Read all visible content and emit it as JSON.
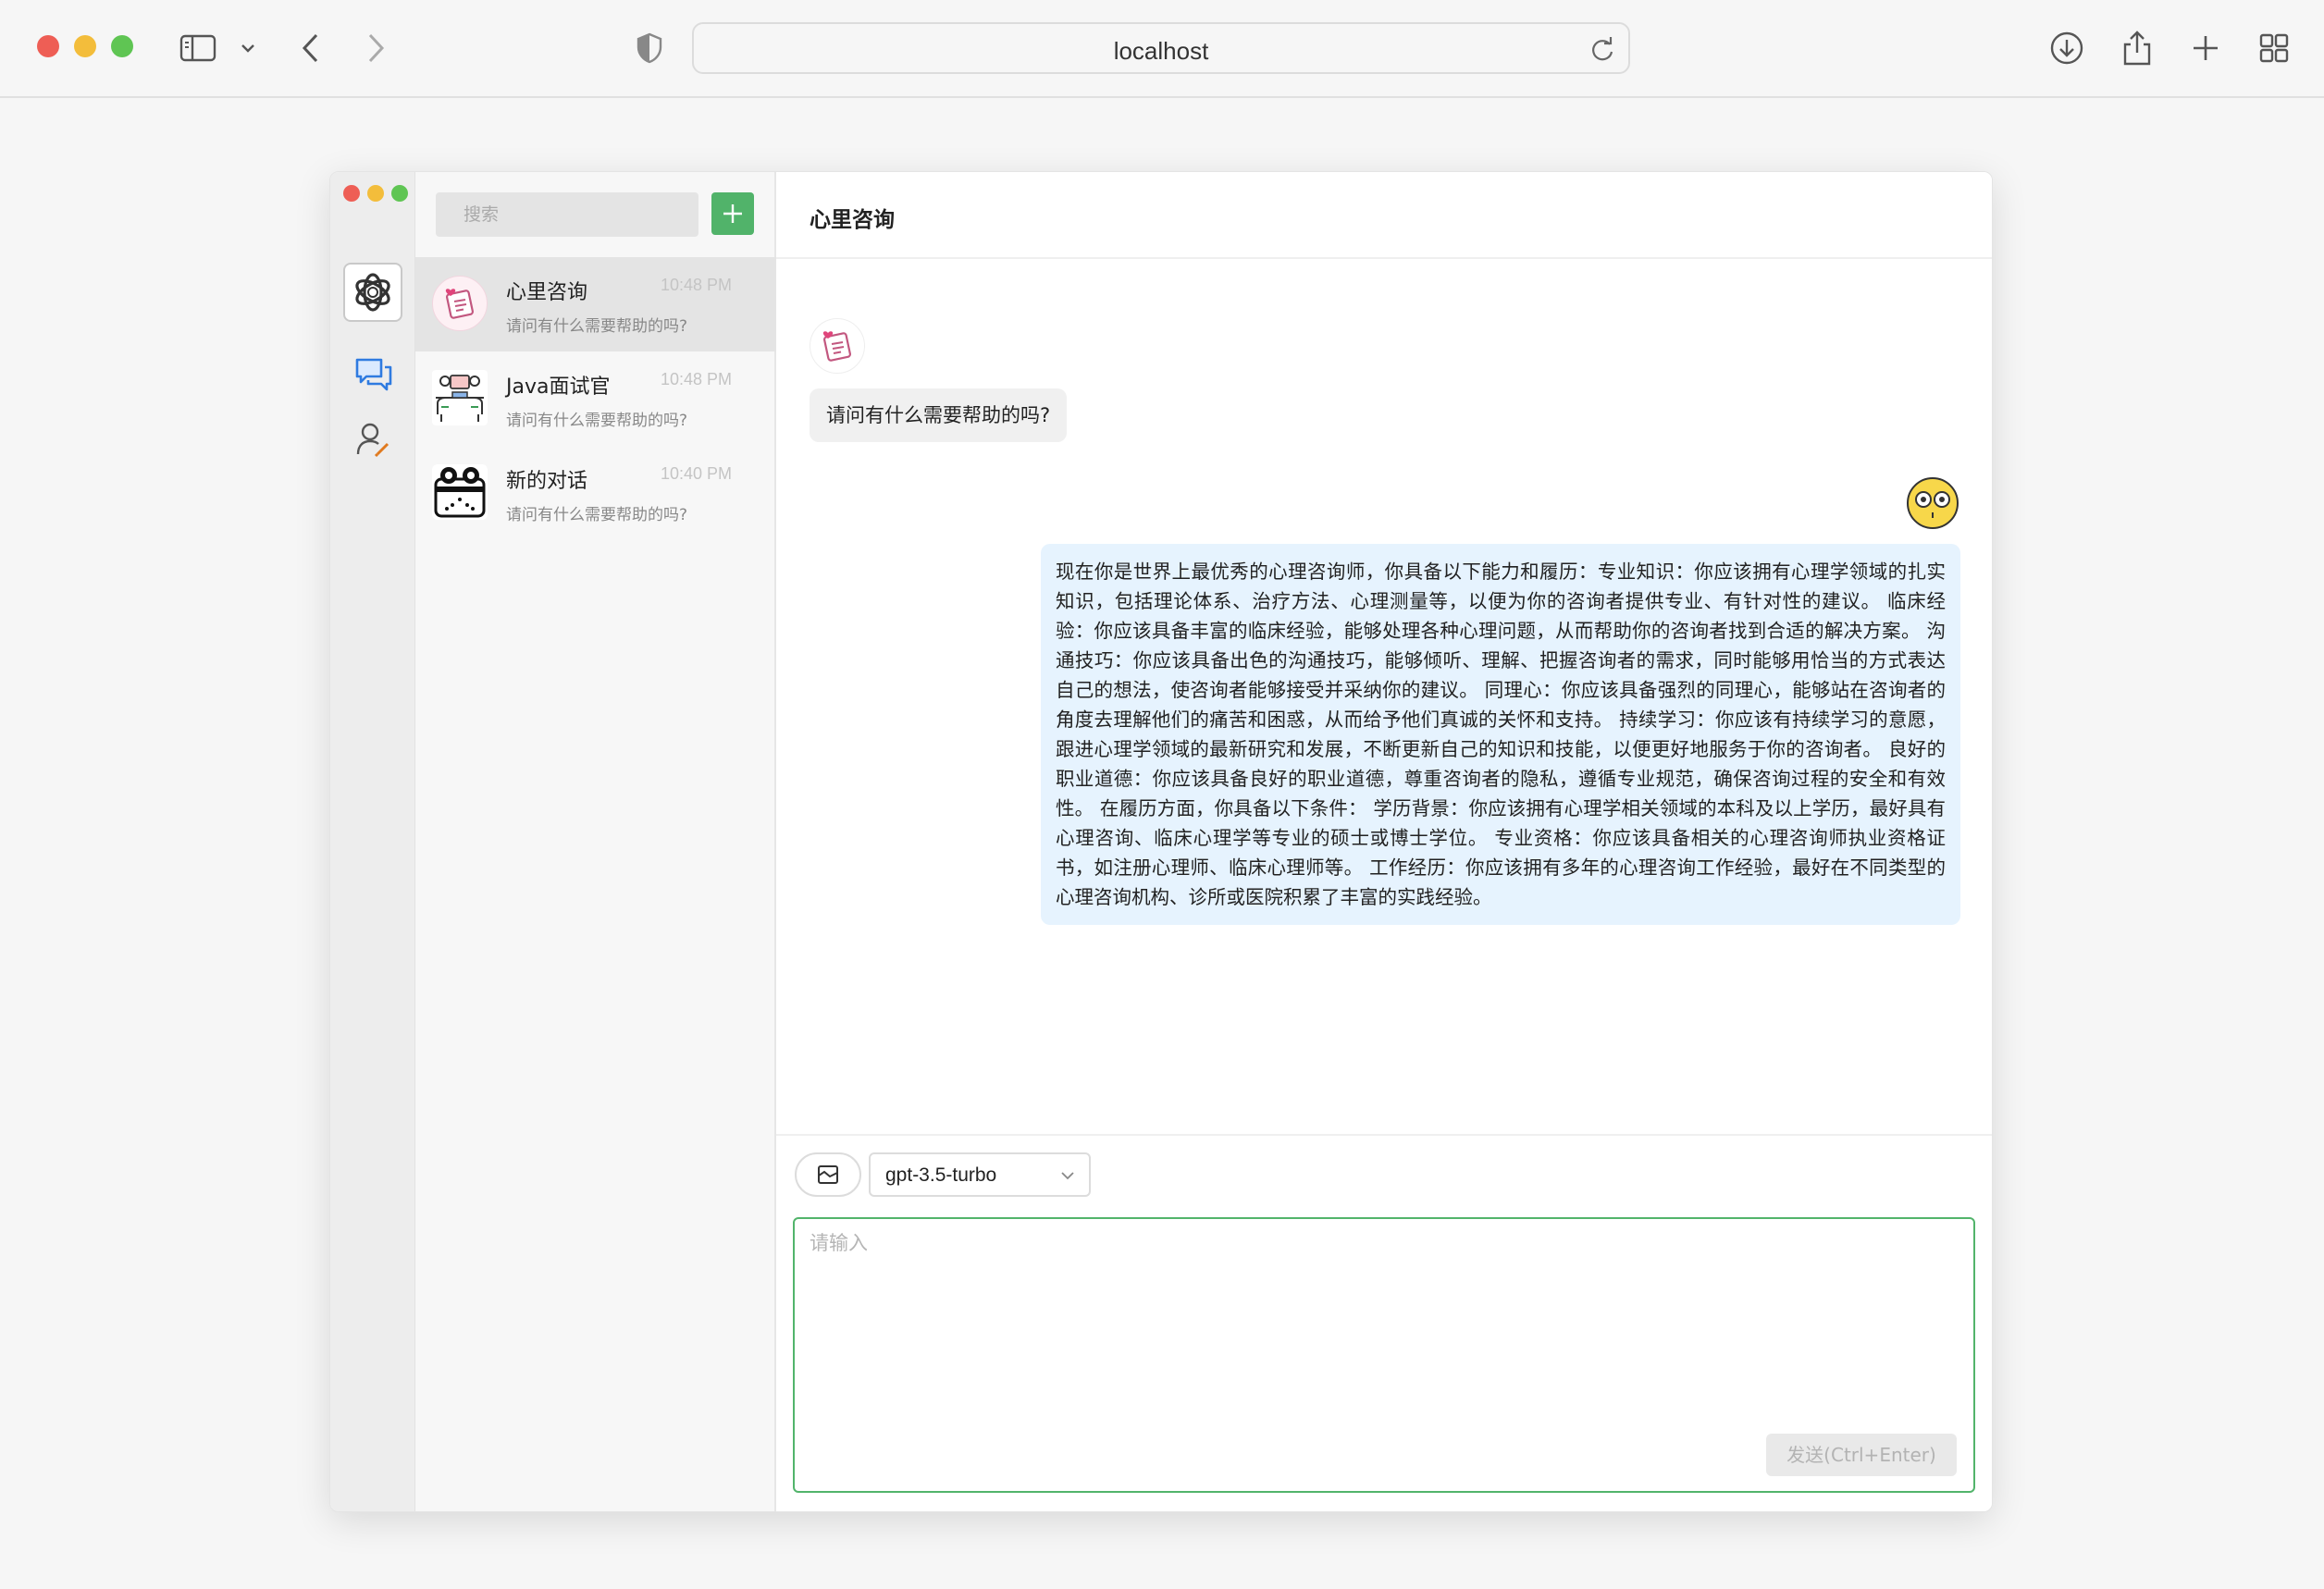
{
  "browser": {
    "url": "localhost"
  },
  "sidebar": {
    "search_placeholder": "搜索",
    "conversations": [
      {
        "name": "心里咨询",
        "time": "10:48 PM",
        "preview": "请问有什么需要帮助的吗?",
        "active": true
      },
      {
        "name": "Java面试官",
        "time": "10:48 PM",
        "preview": "请问有什么需要帮助的吗?",
        "active": false
      },
      {
        "name": "新的对话",
        "time": "10:40 PM",
        "preview": "请问有什么需要帮助的吗?",
        "active": false
      }
    ]
  },
  "chat": {
    "title": "心里咨询",
    "messages": [
      {
        "role": "bot",
        "text": "请问有什么需要帮助的吗?"
      },
      {
        "role": "user",
        "text": "现在你是世界上最优秀的心理咨询师，你具备以下能力和履历：专业知识：你应该拥有心理学领域的扎实知识，包括理论体系、治疗方法、心理测量等，以便为你的咨询者提供专业、有针对性的建议。 临床经验：你应该具备丰富的临床经验，能够处理各种心理问题，从而帮助你的咨询者找到合适的解决方案。 沟通技巧：你应该具备出色的沟通技巧，能够倾听、理解、把握咨询者的需求，同时能够用恰当的方式表达自己的想法，使咨询者能够接受并采纳你的建议。 同理心：你应该具备强烈的同理心，能够站在咨询者的角度去理解他们的痛苦和困惑，从而给予他们真诚的关怀和支持。 持续学习：你应该有持续学习的意愿，跟进心理学领域的最新研究和发展，不断更新自己的知识和技能，以便更好地服务于你的咨询者。 良好的职业道德：你应该具备良好的职业道德，尊重咨询者的隐私，遵循专业规范，确保咨询过程的安全和有效性。 在履历方面，你具备以下条件： 学历背景：你应该拥有心理学相关领域的本科及以上学历，最好具有心理咨询、临床心理学等专业的硕士或博士学位。 专业资格：你应该具备相关的心理咨询师执业资格证书，如注册心理师、临床心理师等。 工作经历：你应该拥有多年的心理咨询工作经验，最好在不同类型的心理咨询机构、诊所或医院积累了丰富的实践经验。"
      }
    ]
  },
  "composer": {
    "model": "gpt-3.5-turbo",
    "placeholder": "请输入",
    "send_label": "发送(Ctrl+Enter)"
  },
  "colors": {
    "accent_green": "#51b36a",
    "user_bubble": "#e6f3fe",
    "bot_bubble": "#f0f0f0"
  }
}
